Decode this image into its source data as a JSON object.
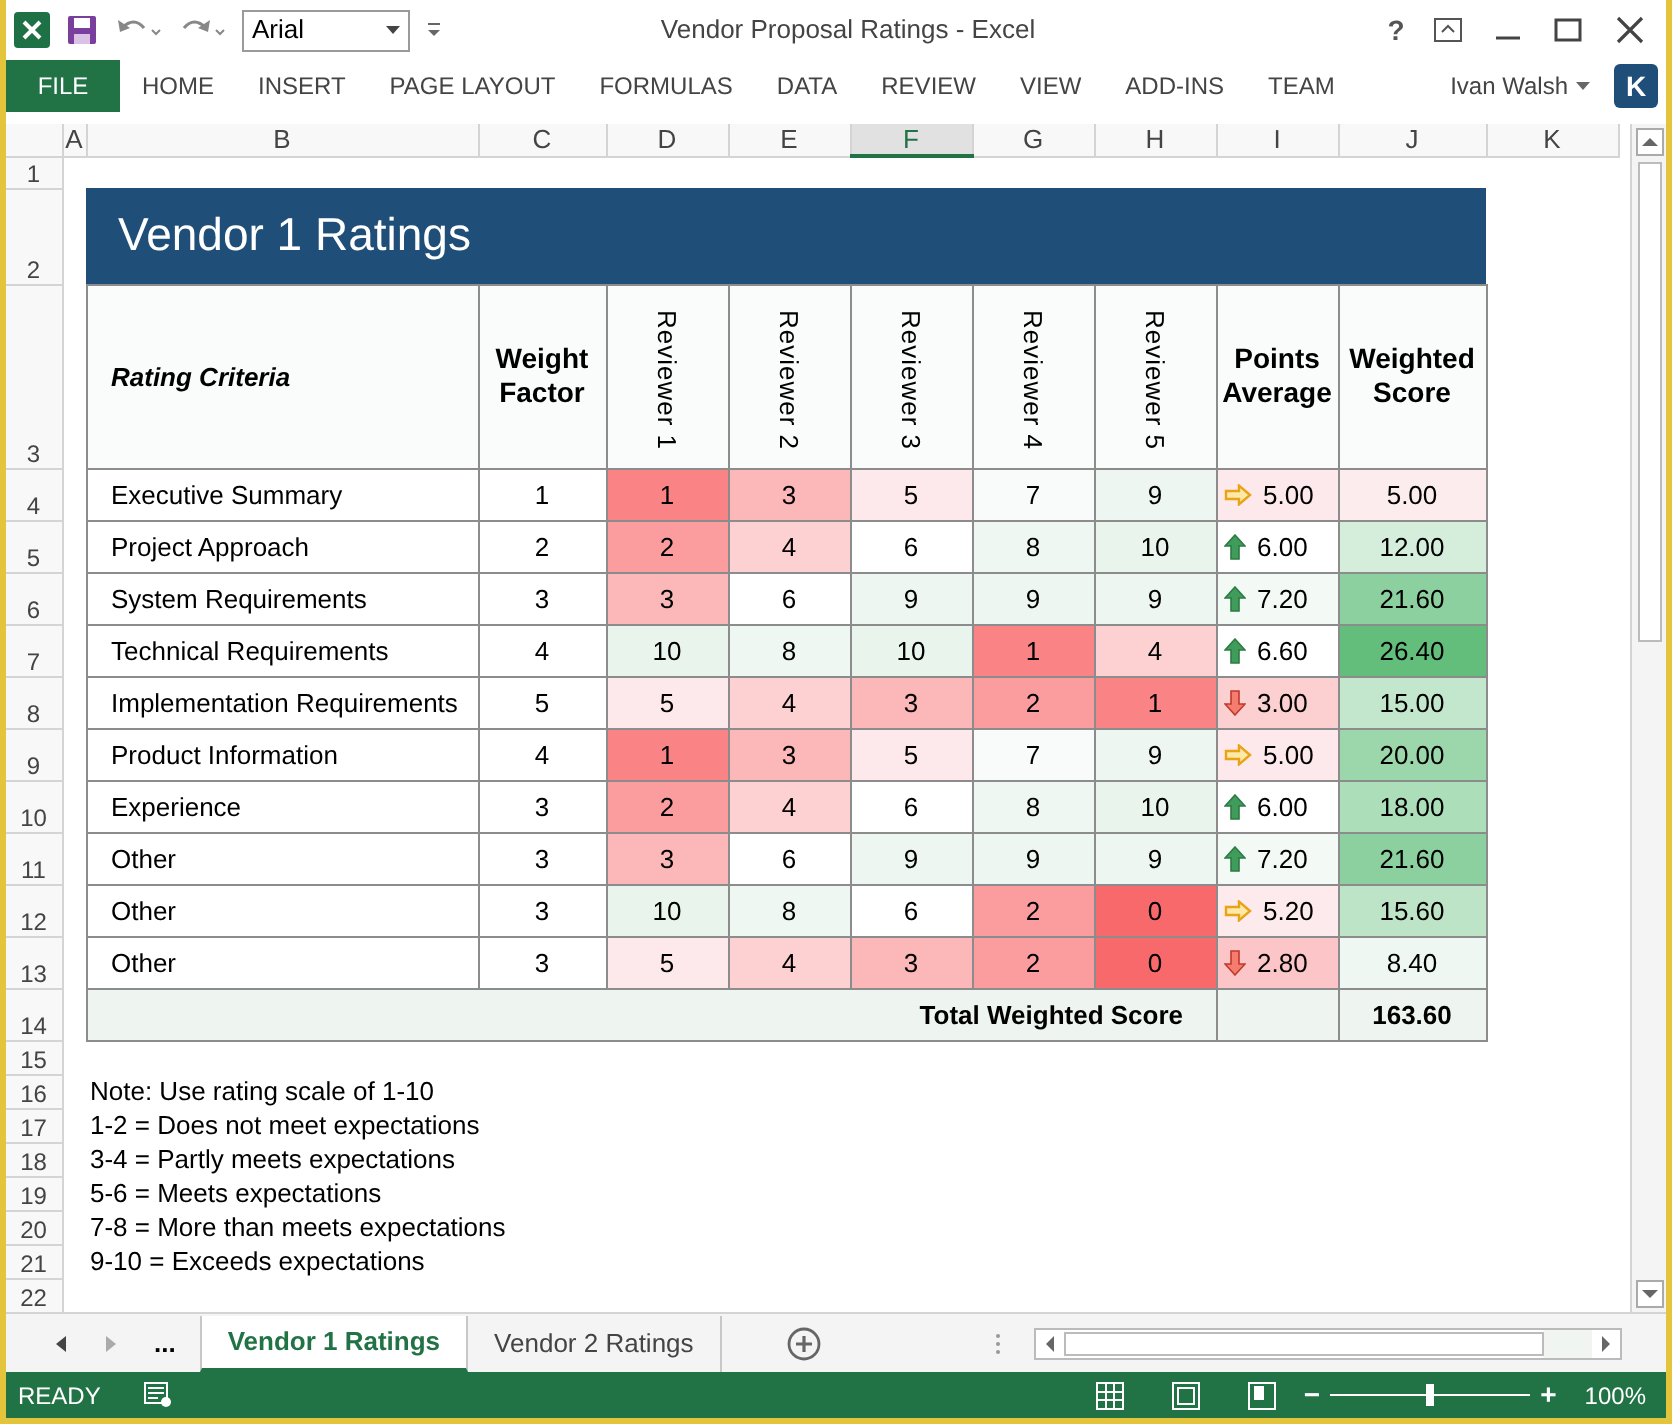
{
  "window": {
    "title": "Vendor Proposal Ratings - Excel",
    "font_box": {
      "value": "Arial"
    },
    "help": "?"
  },
  "ribbon": {
    "file_tab": "FILE",
    "tabs": [
      "HOME",
      "INSERT",
      "PAGE LAYOUT",
      "FORMULAS",
      "DATA",
      "REVIEW",
      "VIEW",
      "ADD-INS",
      "TEAM"
    ],
    "user": "Ivan Walsh",
    "avatar": "K"
  },
  "column_headers": [
    {
      "label": "A",
      "selected": false
    },
    {
      "label": "B",
      "selected": false
    },
    {
      "label": "C",
      "selected": false
    },
    {
      "label": "D",
      "selected": false
    },
    {
      "label": "E",
      "selected": false
    },
    {
      "label": "F",
      "selected": true
    },
    {
      "label": "G",
      "selected": false
    },
    {
      "label": "H",
      "selected": false
    },
    {
      "label": "I",
      "selected": false
    },
    {
      "label": "J",
      "selected": false
    },
    {
      "label": "K",
      "selected": false
    }
  ],
  "row_numbers": [
    "1",
    "2",
    "3",
    "4",
    "5",
    "6",
    "7",
    "8",
    "9",
    "10",
    "11",
    "12",
    "13",
    "14",
    "15",
    "16",
    "17",
    "18",
    "19",
    "20",
    "21",
    "22"
  ],
  "sheet": {
    "title": "Vendor 1 Ratings",
    "headers": {
      "criteria": "Rating Criteria",
      "weight": "Weight Factor",
      "reviewers": [
        "Reviewer 1",
        "Reviewer 2",
        "Reviewer 3",
        "Reviewer 4",
        "Reviewer 5"
      ],
      "average": "Points Average",
      "score": "Weighted Score"
    },
    "rows": [
      {
        "criteria": "Executive Summary",
        "weight": "1",
        "scores": [
          {
            "value": "1",
            "color": "#fa8385"
          },
          {
            "value": "3",
            "color": "#fcb7b8"
          },
          {
            "value": "5",
            "color": "#fde9eb"
          },
          {
            "value": "7",
            "color": "#f8fbf9"
          },
          {
            "value": "9",
            "color": "#edf6f0"
          }
        ],
        "average": {
          "kind": "right",
          "text": "5.00",
          "color": "#fde9eb"
        },
        "score": {
          "text": "5.00",
          "color": "#fdecee"
        }
      },
      {
        "criteria": "Project Approach",
        "weight": "2",
        "scores": [
          {
            "value": "2",
            "color": "#fb9c9e"
          },
          {
            "value": "4",
            "color": "#fdd0d2"
          },
          {
            "value": "6",
            "color": "#ffffff"
          },
          {
            "value": "8",
            "color": "#eef7f1"
          },
          {
            "value": "10",
            "color": "#e8f4ec"
          }
        ],
        "average": {
          "kind": "up",
          "text": "6.00",
          "color": "#ffffff"
        },
        "score": {
          "text": "12.00",
          "color": "#d4eedb"
        }
      },
      {
        "criteria": "System Requirements",
        "weight": "3",
        "scores": [
          {
            "value": "3",
            "color": "#fcb7b8"
          },
          {
            "value": "6",
            "color": "#ffffff"
          },
          {
            "value": "9",
            "color": "#edf6f0"
          },
          {
            "value": "9",
            "color": "#edf6f0"
          },
          {
            "value": "9",
            "color": "#edf6f0"
          }
        ],
        "average": {
          "kind": "up",
          "text": "7.20",
          "color": "#f3f9f5"
        },
        "score": {
          "text": "21.60",
          "color": "#8bd09e"
        }
      },
      {
        "criteria": "Technical Requirements",
        "weight": "4",
        "scores": [
          {
            "value": "10",
            "color": "#e8f4ec"
          },
          {
            "value": "8",
            "color": "#eef7f1"
          },
          {
            "value": "10",
            "color": "#e8f4ec"
          },
          {
            "value": "1",
            "color": "#fa8385"
          },
          {
            "value": "4",
            "color": "#fdd0d2"
          }
        ],
        "average": {
          "kind": "up",
          "text": "6.60",
          "color": "#ffffff"
        },
        "score": {
          "text": "26.40",
          "color": "#63be7b"
        }
      },
      {
        "criteria": "Implementation Requirements",
        "weight": "5",
        "scores": [
          {
            "value": "5",
            "color": "#fde9eb"
          },
          {
            "value": "4",
            "color": "#fdd0d2"
          },
          {
            "value": "3",
            "color": "#fcb7b8"
          },
          {
            "value": "2",
            "color": "#fb9c9e"
          },
          {
            "value": "1",
            "color": "#fa8385"
          }
        ],
        "average": {
          "kind": "down",
          "text": "3.00",
          "color": "#fccfd1"
        },
        "score": {
          "text": "15.00",
          "color": "#c3e7cc"
        }
      },
      {
        "criteria": "Product Information",
        "weight": "4",
        "scores": [
          {
            "value": "1",
            "color": "#fa8385"
          },
          {
            "value": "3",
            "color": "#fcb7b8"
          },
          {
            "value": "5",
            "color": "#fde9eb"
          },
          {
            "value": "7",
            "color": "#f8fbf9"
          },
          {
            "value": "9",
            "color": "#edf6f0"
          }
        ],
        "average": {
          "kind": "right",
          "text": "5.00",
          "color": "#fde9eb"
        },
        "score": {
          "text": "20.00",
          "color": "#9bd7ab"
        }
      },
      {
        "criteria": "Experience",
        "weight": "3",
        "scores": [
          {
            "value": "2",
            "color": "#fb9c9e"
          },
          {
            "value": "4",
            "color": "#fdd0d2"
          },
          {
            "value": "6",
            "color": "#ffffff"
          },
          {
            "value": "8",
            "color": "#eef7f1"
          },
          {
            "value": "10",
            "color": "#e8f4ec"
          }
        ],
        "average": {
          "kind": "up",
          "text": "6.00",
          "color": "#ffffff"
        },
        "score": {
          "text": "18.00",
          "color": "#acdeb9"
        }
      },
      {
        "criteria": "Other",
        "weight": "3",
        "scores": [
          {
            "value": "3",
            "color": "#fcb7b8"
          },
          {
            "value": "6",
            "color": "#ffffff"
          },
          {
            "value": "9",
            "color": "#edf6f0"
          },
          {
            "value": "9",
            "color": "#edf6f0"
          },
          {
            "value": "9",
            "color": "#edf6f0"
          }
        ],
        "average": {
          "kind": "up",
          "text": "7.20",
          "color": "#f3f9f5"
        },
        "score": {
          "text": "21.60",
          "color": "#8bd09e"
        }
      },
      {
        "criteria": "Other",
        "weight": "3",
        "scores": [
          {
            "value": "10",
            "color": "#e8f4ec"
          },
          {
            "value": "8",
            "color": "#eef7f1"
          },
          {
            "value": "6",
            "color": "#ffffff"
          },
          {
            "value": "2",
            "color": "#fb9c9e"
          },
          {
            "value": "0",
            "color": "#f8696b"
          }
        ],
        "average": {
          "kind": "right",
          "text": "5.20",
          "color": "#fdeaec"
        },
        "score": {
          "text": "15.60",
          "color": "#bde4c6"
        }
      },
      {
        "criteria": "Other",
        "weight": "3",
        "scores": [
          {
            "value": "5",
            "color": "#fde9eb"
          },
          {
            "value": "4",
            "color": "#fdd0d2"
          },
          {
            "value": "3",
            "color": "#fcb7b8"
          },
          {
            "value": "2",
            "color": "#fb9c9e"
          },
          {
            "value": "0",
            "color": "#f8696b"
          }
        ],
        "average": {
          "kind": "down",
          "text": "2.80",
          "color": "#fcc6c8"
        },
        "score": {
          "text": "8.40",
          "color": "#eff7f2"
        }
      }
    ],
    "total": {
      "label": "Total Weighted Score",
      "value": "163.60"
    },
    "notes": [
      "Note: Use rating scale of 1-10",
      "1-2 = Does not meet expectations",
      "3-4 = Partly meets expectations",
      "5-6 = Meets expectations",
      "7-8 = More than meets expectations",
      "9-10 = Exceeds expectations"
    ]
  },
  "sheet_tabs": {
    "overflow": "...",
    "tabs": [
      {
        "label": "Vendor 1 Ratings",
        "selected": true
      },
      {
        "label": "Vendor 2 Ratings",
        "selected": false
      }
    ]
  },
  "status_bar": {
    "status": "READY",
    "zoom": {
      "out": "−",
      "level": 0.5,
      "in": "+",
      "reading": "100%"
    }
  }
}
